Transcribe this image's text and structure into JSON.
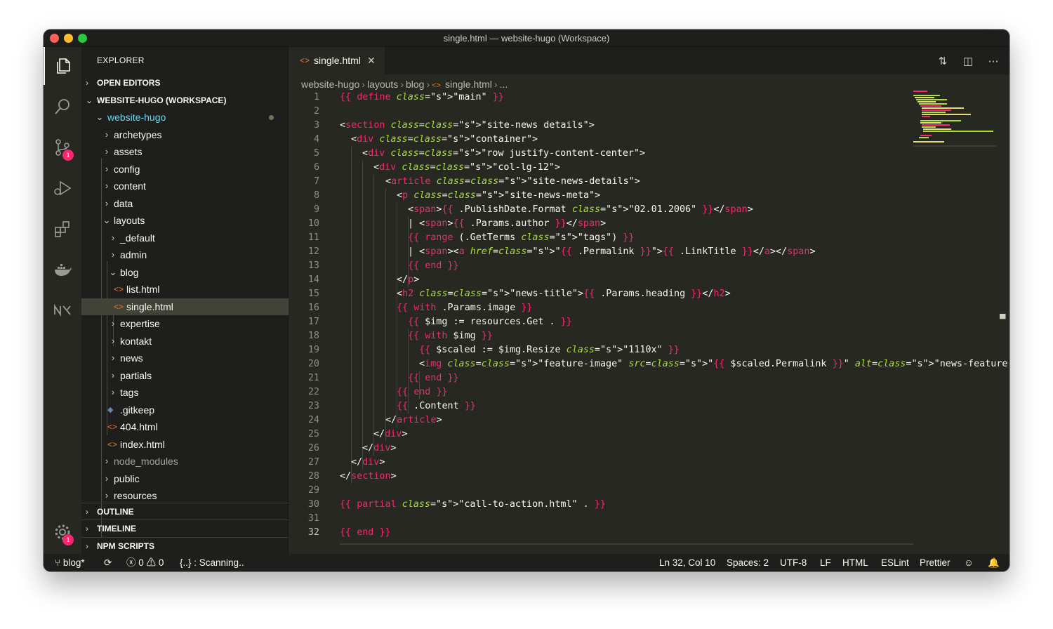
{
  "window": {
    "title": "single.html — website-hugo (Workspace)"
  },
  "activity": {
    "scm_badge": "1",
    "settings_badge": "1"
  },
  "sidebar": {
    "title": "EXPLORER",
    "sections": {
      "open_editors": "OPEN EDITORS",
      "workspace": "WEBSITE-HUGO (WORKSPACE)",
      "outline": "OUTLINE",
      "timeline": "TIMELINE",
      "npm": "NPM SCRIPTS"
    },
    "tree": {
      "root": "website-hugo",
      "archetypes": "archetypes",
      "assets": "assets",
      "config": "config",
      "content": "content",
      "data": "data",
      "layouts": "layouts",
      "default": "_default",
      "admin": "admin",
      "blog": "blog",
      "list": "list.html",
      "single": "single.html",
      "expertise": "expertise",
      "kontakt": "kontakt",
      "news": "news",
      "partials": "partials",
      "tags": "tags",
      "gitkeep": ".gitkeep",
      "p404": "404.html",
      "index": "index.html",
      "node_modules": "node_modules",
      "public": "public",
      "resources": "resources"
    }
  },
  "tab": {
    "label": "single.html"
  },
  "breadcrumb": {
    "b1": "website-hugo",
    "b2": "layouts",
    "b3": "blog",
    "b4": "single.html",
    "b5": "..."
  },
  "code": {
    "numbers": [
      "1",
      "2",
      "3",
      "4",
      "5",
      "6",
      "7",
      "8",
      "9",
      "10",
      "11",
      "12",
      "13",
      "14",
      "15",
      "16",
      "17",
      "18",
      "19",
      "20",
      "21",
      "22",
      "23",
      "24",
      "25",
      "26",
      "27",
      "28",
      "29",
      "30",
      "31",
      "32"
    ],
    "l1": "{{ define \"main\" }}",
    "l3": "<section class=\"site-news details\">",
    "l4": "<div class=\"container\">",
    "l5": "<div class=\"row justify-content-center\">",
    "l6": "<div class=\"col-lg-12\">",
    "l7": "<article class=\"site-news-details\">",
    "l8": "<p class=\"site-news-meta\">",
    "l9": "<span>{{ .PublishDate.Format \"02.01.2006\" }}</span>",
    "l10": "| <span>{{ .Params.author }}</span>",
    "l11": "{{ range (.GetTerms \"tags\") }}",
    "l12": "| <span><a href=\"{{ .Permalink }}\">{{ .LinkTitle }}</a></span>",
    "l13": "{{ end }}",
    "l14": "</p>",
    "l15": "<h2 class=\"news-title\">{{ .Params.heading }}</h2>",
    "l16": "{{ with .Params.image }}",
    "l17": "{{ $img := resources.Get . }}",
    "l18": "{{ with $img }}",
    "l19": "{{ $scaled := $img.Resize \"1110x\" }}",
    "l20": "<img class=\"feature-image\" src=\"{{ $scaled.Permalink }}\" alt=\"news-feature-image\">",
    "l21": "{{ end }}",
    "l22": "{{ end }}",
    "l23": "{{ .Content }}",
    "l24": "</article>",
    "l25": "</div>",
    "l26": "</div>",
    "l27": "</div>",
    "l28": "</section>",
    "l30": "{{ partial \"call-to-action.html\" . }}",
    "l32": "{{ end }}"
  },
  "status": {
    "branch": "blog*",
    "errors": "0",
    "warnings": "0",
    "scanning": "{..} : Scanning..",
    "position": "Ln 32, Col 10",
    "spaces": "Spaces: 2",
    "encoding": "UTF-8",
    "eol": "LF",
    "language": "HTML",
    "eslint": "ESLint",
    "prettier": "Prettier"
  },
  "colors": {
    "background": "#272822",
    "sidebar": "#1e1f1c",
    "keyword": "#f92672",
    "string": "#e6db74",
    "attribute": "#a6e22e",
    "folder_root": "#66d9ef"
  }
}
